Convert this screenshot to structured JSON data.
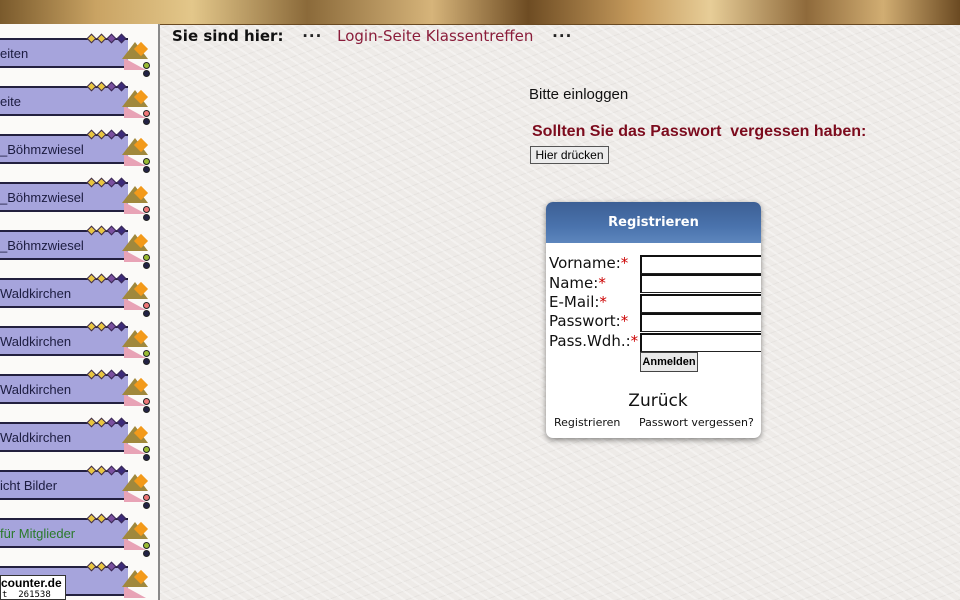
{
  "sidebar": {
    "items": [
      {
        "label": "eiten"
      },
      {
        "label": "eite"
      },
      {
        "label": "_Böhmzwiesel"
      },
      {
        "label": "_Böhmzwiesel"
      },
      {
        "label": "_Böhmzwiesel"
      },
      {
        "label": "Waldkirchen"
      },
      {
        "label": "Waldkirchen"
      },
      {
        "label": "Waldkirchen"
      },
      {
        "label": "Waldkirchen"
      },
      {
        "label": "icht Bilder"
      },
      {
        "label": " für Mitglieder"
      },
      {
        "label": ""
      }
    ],
    "counter": {
      "site": "counter.de",
      "value": "t  261538"
    }
  },
  "breadcrumb": {
    "prefix": "Sie sind hier:",
    "dots": "···",
    "current": "Login-Seite Klassentreffen",
    "dots_after": "···"
  },
  "main": {
    "login_prompt": "Bitte einloggen",
    "forgot_message": "Sollten Sie das Passwort  vergessen haben:",
    "forgot_button": "Hier drücken"
  },
  "register": {
    "title": "Registrieren",
    "fields": [
      {
        "label": "Vorname:",
        "req": "*"
      },
      {
        "label": "Name:",
        "req": "*"
      },
      {
        "label": "E-Mail:",
        "req": "*"
      },
      {
        "label": "Passwort:",
        "req": "*"
      },
      {
        "label": "Pass.Wdh.:",
        "req": "*"
      }
    ],
    "submit": "Anmelden",
    "back": "Zurück",
    "register_link": "Registrieren",
    "forgot_link": "Passwort vergessen?"
  },
  "colors": {
    "accent_red": "#7c0b1d",
    "breadcrumb_link": "#8a1c3a",
    "panel_header": "#4a73ad",
    "nav_bar": "#a6a4dc"
  }
}
